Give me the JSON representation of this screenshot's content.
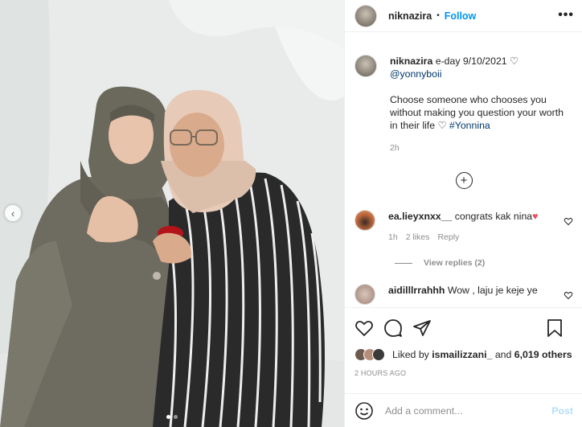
{
  "post": {
    "username": "niknazira",
    "follow_label": "Follow",
    "separator": "•",
    "more_label": "•••"
  },
  "caption": {
    "username": "niknazira",
    "text": "e-day 9/10/2021",
    "mention": "@yonnyboii",
    "body": "Choose someone who chooses you without making you question your worth in their life",
    "hashtag": "#Yonnina",
    "time": "2h"
  },
  "comments": [
    {
      "username": "ea.lieyxnxx__",
      "text": "congrats kak nina",
      "time": "1h",
      "likes": "2 likes",
      "reply_label": "Reply",
      "view_replies": "View replies (2)"
    },
    {
      "username": "aidilllrrahhh",
      "text": "Wow , laju je keje ye"
    }
  ],
  "likes": {
    "prefix": "Liked by",
    "user": "ismailizzani_",
    "conjunction": "and",
    "count": "6,019 others"
  },
  "timestamp": "2 HOURS AGO",
  "add_comment": {
    "placeholder": "Add a comment...",
    "post_label": "Post"
  },
  "icons": {
    "more": "more-options-icon",
    "like": "heart-icon",
    "comment": "comment-icon",
    "share": "share-icon",
    "save": "bookmark-icon",
    "emoji": "emoji-icon",
    "load_more": "plus-circle-icon",
    "prev": "chevron-left-icon"
  },
  "colors": {
    "accent": "#0095f6",
    "link": "#00376b",
    "muted": "#8e8e8e",
    "heart": "#ed4956"
  }
}
